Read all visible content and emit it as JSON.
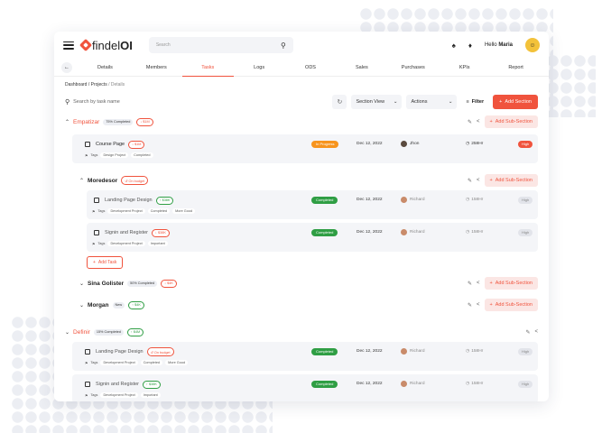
{
  "header": {
    "logo_text_bold": "findel",
    "logo_text_suffix": "OI",
    "search_placeholder": "Search",
    "greeting": "Hello",
    "user_name": "Maria"
  },
  "tabs": [
    "Details",
    "Members",
    "Tasks",
    "Logs",
    "ODS",
    "Sales",
    "Purchases",
    "KPIs",
    "Report"
  ],
  "active_tab": "Tasks",
  "breadcrumb": {
    "path": "Dashboard / Projects",
    "current": "Details"
  },
  "toolbar": {
    "search_placeholder": "Search by task name",
    "section_view": "Section View",
    "actions": "Actions",
    "filter": "Filter",
    "add_section": "Add Section"
  },
  "labels": {
    "add_sub_section": "Add Sub-Section",
    "add_task": "Add Task",
    "tags": "Tags"
  },
  "colors": {
    "accent": "#f0533d",
    "completed": "#2f9e44",
    "in_progress": "#f7941d"
  },
  "sections": {
    "empatizar": {
      "title": "Empatizar",
      "completed": "75% Completed",
      "budget": "$1M"
    },
    "course_page": {
      "name": "Course Page",
      "budget": "$1M",
      "tags": [
        "Design Project",
        "Completed"
      ],
      "status": "In Progress",
      "date": "Dec 12, 2022",
      "assignee": "Jhon",
      "hours": "258Hr",
      "priority": "High"
    },
    "moredesor": {
      "title": "Moredesor",
      "budget": "On budget"
    },
    "landing": {
      "name": "Landing Page Design",
      "budget": "$38K",
      "tags": [
        "Development Project",
        "Completed",
        "More Good"
      ],
      "status": "Completed",
      "date": "Dec 12, 2022",
      "assignee": "Richard",
      "hours": "158Hr",
      "priority": "High"
    },
    "signin": {
      "name": "Signin and Register",
      "budget": "$38K",
      "tags": [
        "Development Project",
        "Important"
      ],
      "status": "Completed",
      "date": "Dec 12, 2022",
      "assignee": "Richard",
      "hours": "158Hr",
      "priority": "High"
    },
    "sina": {
      "title": "Sina Golister",
      "completed": "50% Completed",
      "budget": "$4K"
    },
    "morgan": {
      "title": "Morgan",
      "tag": "New",
      "budget": "$4K"
    },
    "definir": {
      "title": "Definir",
      "completed": "15% Completed",
      "budget": "$4M"
    },
    "landing2": {
      "name": "Landing Page Design",
      "budget": "On budget",
      "tags": [
        "Development Project",
        "Completed",
        "More Good"
      ],
      "status": "Completed",
      "date": "Dec 12, 2022",
      "assignee": "Richard",
      "hours": "158Hr",
      "priority": "High"
    },
    "signin2": {
      "name": "Signin and Register",
      "budget": "$38K",
      "tags": [
        "Development Project",
        "Important"
      ],
      "status": "Completed",
      "date": "Dec 12, 2022",
      "assignee": "Richard",
      "hours": "158Hr",
      "priority": "High"
    }
  }
}
